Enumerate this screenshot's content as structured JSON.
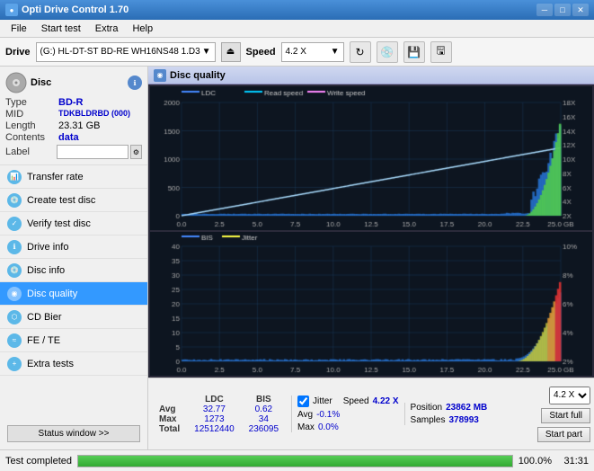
{
  "app": {
    "title": "Opti Drive Control 1.70",
    "icon": "●"
  },
  "titlebar": {
    "minimize": "─",
    "maximize": "□",
    "close": "✕"
  },
  "menu": {
    "items": [
      "File",
      "Start test",
      "Extra",
      "Help"
    ]
  },
  "drive_bar": {
    "label": "Drive",
    "drive_text": "(G:) HL-DT-ST BD-RE  WH16NS48 1.D3",
    "speed_label": "Speed",
    "speed_value": "4.2 X"
  },
  "disc": {
    "title": "Disc",
    "type_label": "Type",
    "type_value": "BD-R",
    "mid_label": "MID",
    "mid_value": "TDKBLDRBD (000)",
    "length_label": "Length",
    "length_value": "23.31 GB",
    "contents_label": "Contents",
    "contents_value": "data",
    "label_label": "Label"
  },
  "sidebar": {
    "items": [
      {
        "id": "transfer-rate",
        "label": "Transfer rate",
        "active": false
      },
      {
        "id": "create-test-disc",
        "label": "Create test disc",
        "active": false
      },
      {
        "id": "verify-test-disc",
        "label": "Verify test disc",
        "active": false
      },
      {
        "id": "drive-info",
        "label": "Drive info",
        "active": false
      },
      {
        "id": "disc-info",
        "label": "Disc info",
        "active": false
      },
      {
        "id": "disc-quality",
        "label": "Disc quality",
        "active": true
      },
      {
        "id": "cd-bier",
        "label": "CD Bier",
        "active": false
      },
      {
        "id": "fe-te",
        "label": "FE / TE",
        "active": false
      },
      {
        "id": "extra-tests",
        "label": "Extra tests",
        "active": false
      }
    ],
    "status_btn": "Status window >>"
  },
  "disc_quality": {
    "title": "Disc quality",
    "legend": {
      "ldc": "LDC",
      "read_speed": "Read speed",
      "write_speed": "Write speed",
      "bis": "BIS",
      "jitter": "Jitter"
    }
  },
  "chart1": {
    "y_max": 2000,
    "y_labels": [
      "2000",
      "1500",
      "1000",
      "500",
      "0"
    ],
    "y_right_labels": [
      "18X",
      "16X",
      "14X",
      "12X",
      "10X",
      "8X",
      "6X",
      "4X",
      "2X"
    ],
    "x_labels": [
      "0.0",
      "2.5",
      "5.0",
      "7.5",
      "10.0",
      "12.5",
      "15.0",
      "17.5",
      "20.0",
      "22.5",
      "25.0 GB"
    ]
  },
  "chart2": {
    "y_labels": [
      "40",
      "35",
      "30",
      "25",
      "20",
      "15",
      "10",
      "5"
    ],
    "y_right_labels": [
      "10%",
      "8%",
      "6%",
      "4%",
      "2%"
    ],
    "x_labels": [
      "0.0",
      "2.5",
      "5.0",
      "7.5",
      "10.0",
      "12.5",
      "15.0",
      "17.5",
      "20.0",
      "22.5",
      "25.0 GB"
    ]
  },
  "stats": {
    "headers": [
      "LDC",
      "BIS"
    ],
    "jitter_header": "Jitter",
    "speed_header": "Speed",
    "speed_value": "4.22 X",
    "avg_label": "Avg",
    "avg_ldc": "32.77",
    "avg_bis": "0.62",
    "avg_jitter": "-0.1%",
    "max_label": "Max",
    "max_ldc": "1273",
    "max_bis": "34",
    "max_jitter": "0.0%",
    "total_label": "Total",
    "total_ldc": "12512440",
    "total_bis": "236095",
    "position_label": "Position",
    "position_value": "23862 MB",
    "samples_label": "Samples",
    "samples_value": "378993",
    "start_full": "Start full",
    "start_part": "Start part",
    "speed_select": "4.2 X",
    "jitter_checked": true
  },
  "status_bar": {
    "text": "Test completed",
    "progress": 100,
    "progress_text": "100.0%",
    "time": "31:31"
  }
}
